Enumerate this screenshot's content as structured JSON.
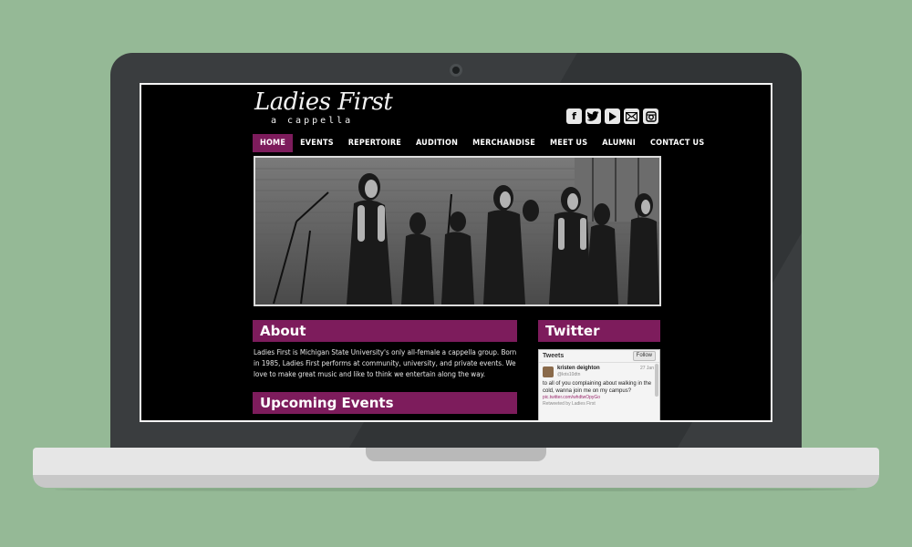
{
  "site": {
    "logo": {
      "main": "Ladies First",
      "sub": "a cappella"
    },
    "social_icons": [
      "facebook-icon",
      "twitter-icon",
      "youtube-icon",
      "email-icon",
      "instagram-icon"
    ],
    "nav": [
      {
        "label": "HOME"
      },
      {
        "label": "EVENTS"
      },
      {
        "label": "REPERTOIRE"
      },
      {
        "label": "AUDITION"
      },
      {
        "label": "MERCHANDISE"
      },
      {
        "label": "MEET US"
      },
      {
        "label": "ALUMNI"
      },
      {
        "label": "CONTACT US"
      }
    ],
    "about": {
      "heading": "About",
      "text": "Ladies First is Michigan State University's only all-female a cappella group. Born in 1985, Ladies First performs at community, university, and private events. We love to make great music and like to think we entertain along the way."
    },
    "events": {
      "heading": "Upcoming Events"
    },
    "twitter": {
      "heading": "Twitter",
      "widget_title": "Tweets",
      "follow_label": "Follow",
      "tweet": {
        "name": "kristen deighton",
        "handle": "@kris10dtn",
        "date": "27 Jan",
        "text": "to all of you complaining about walking in the cold, wanna join me on my campus?",
        "link": "pic.twitter.com/whdtwOpyGo",
        "retweet": "Retweeted by Ladies First"
      }
    }
  },
  "colors": {
    "background": "#95b996",
    "accent": "#7d1c5c",
    "site_bg": "#000000"
  }
}
